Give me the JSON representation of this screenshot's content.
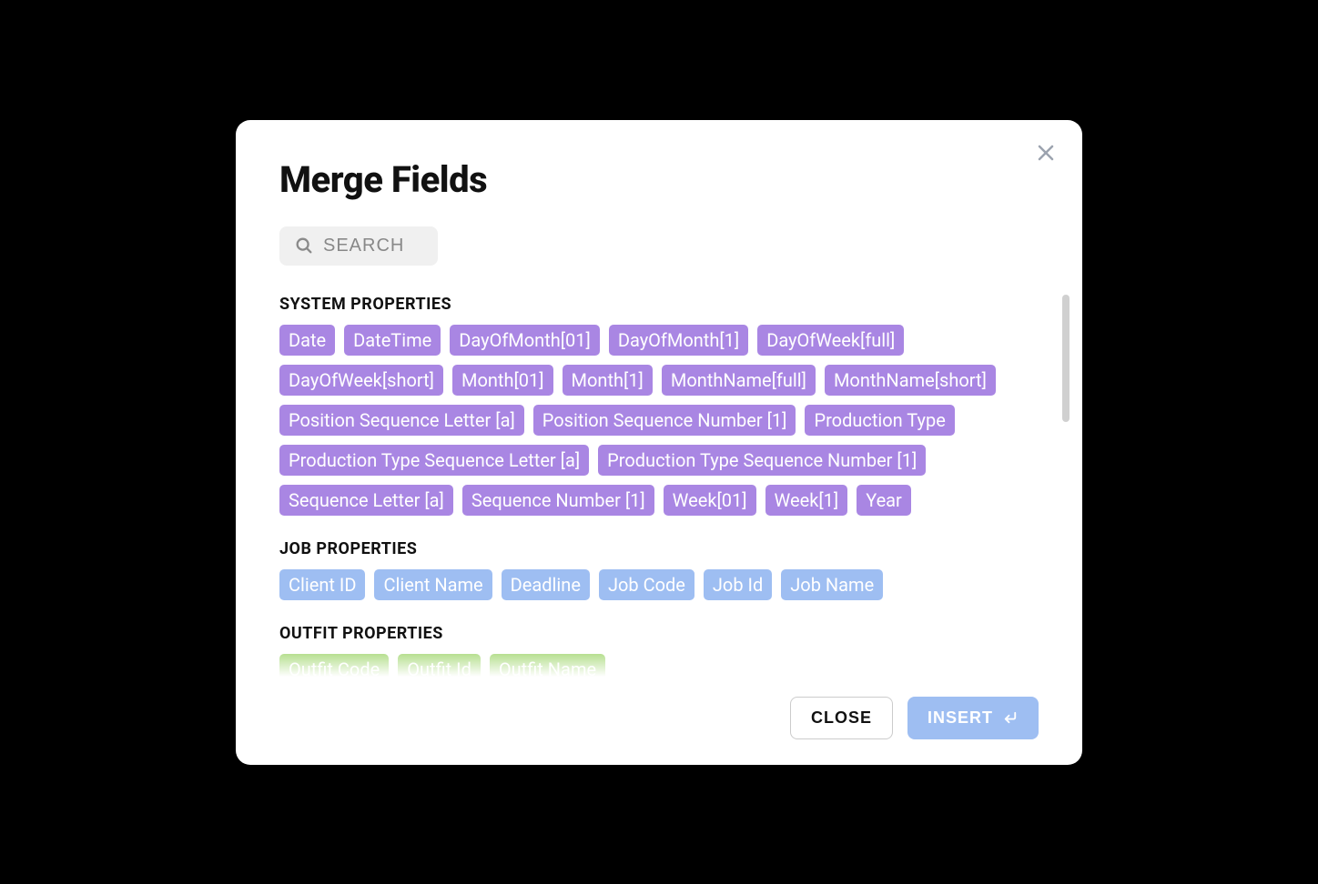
{
  "title": "Merge Fields",
  "search": {
    "placeholder": "SEARCH"
  },
  "sections": {
    "system": {
      "title": "SYSTEM PROPERTIES",
      "tags": [
        "Date",
        "DateTime",
        "DayOfMonth[01]",
        "DayOfMonth[1]",
        "DayOfWeek[full]",
        "DayOfWeek[short]",
        "Month[01]",
        "Month[1]",
        "MonthName[full]",
        "MonthName[short]",
        "Position Sequence Letter [a]",
        "Position Sequence Number [1]",
        "Production Type",
        "Production Type Sequence Letter [a]",
        "Production Type Sequence Number [1]",
        "Sequence Letter [a]",
        "Sequence Number [1]",
        "Week[01]",
        "Week[1]",
        "Year"
      ]
    },
    "job": {
      "title": "JOB PROPERTIES",
      "tags": [
        "Client ID",
        "Client Name",
        "Deadline",
        "Job Code",
        "Job Id",
        "Job Name"
      ]
    },
    "outfit": {
      "title": "OUTFIT PROPERTIES",
      "tags": [
        "Outfit Code",
        "Outfit Id",
        "Outfit Name"
      ]
    }
  },
  "footer": {
    "close": "CLOSE",
    "insert": "INSERT"
  }
}
